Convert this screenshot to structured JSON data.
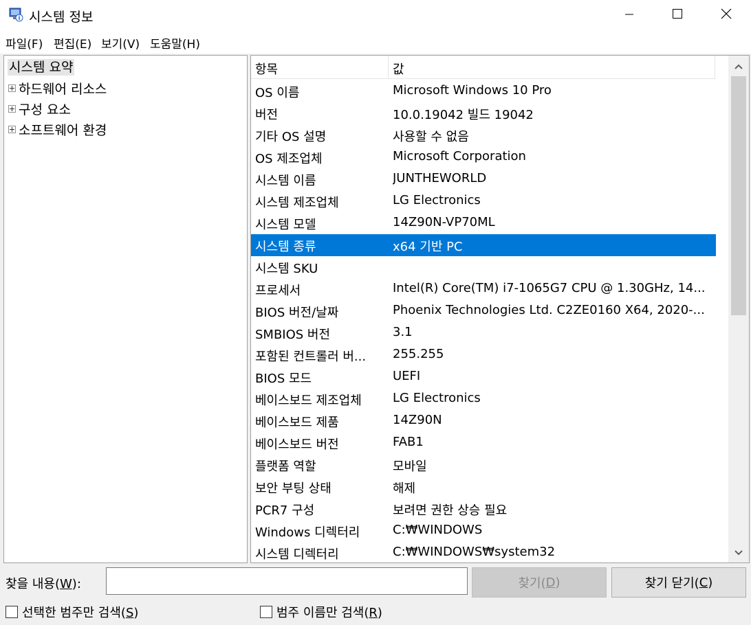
{
  "window": {
    "title": "시스템 정보"
  },
  "menu": [
    "파일(F)",
    "편집(E)",
    "보기(V)",
    "도움말(H)"
  ],
  "tree": {
    "root": "시스템 요약",
    "nodes": [
      "하드웨어 리소스",
      "구성 요소",
      "소프트웨어 환경"
    ]
  },
  "list": {
    "headers": [
      "항목",
      "값"
    ],
    "rows": [
      [
        "OS 이름",
        "Microsoft Windows 10 Pro"
      ],
      [
        "버전",
        "10.0.19042 빌드 19042"
      ],
      [
        "기타 OS 설명",
        "사용할 수 없음"
      ],
      [
        "OS 제조업체",
        "Microsoft Corporation"
      ],
      [
        "시스템 이름",
        "JUNTHEWORLD"
      ],
      [
        "시스템 제조업체",
        "LG Electronics"
      ],
      [
        "시스템 모델",
        "14Z90N-VP70ML"
      ],
      [
        "시스템 종류",
        "x64 기반 PC"
      ],
      [
        "시스템 SKU",
        ""
      ],
      [
        "프로세서",
        "Intel(R) Core(TM) i7-1065G7 CPU @ 1.30GHz, 14..."
      ],
      [
        "BIOS 버전/날짜",
        "Phoenix Technologies Ltd. C2ZE0160 X64, 2020-..."
      ],
      [
        "SMBIOS 버전",
        "3.1"
      ],
      [
        "포함된 컨트롤러 버...",
        "255.255"
      ],
      [
        "BIOS 모드",
        "UEFI"
      ],
      [
        "베이스보드 제조업체",
        "LG Electronics"
      ],
      [
        "베이스보드 제품",
        "14Z90N"
      ],
      [
        "베이스보드 버전",
        "FAB1"
      ],
      [
        "플랫폼 역할",
        "모바일"
      ],
      [
        "보안 부팅 상태",
        "해제"
      ],
      [
        "PCR7 구성",
        "보려면 권한 상승 필요"
      ],
      [
        "Windows 디렉터리",
        "C:₩WINDOWS"
      ],
      [
        "시스템 디렉터리",
        "C:₩WINDOWS₩system32"
      ]
    ],
    "selected_index": 7
  },
  "find": {
    "label_prefix": "찾을 내용(",
    "label_key": "W",
    "label_suffix": "):",
    "value": "",
    "find_button_prefix": "찾기(",
    "find_button_key": "D",
    "find_button_suffix": ")",
    "close_button_prefix": "찾기 닫기(",
    "close_button_key": "C",
    "close_button_suffix": ")",
    "check1_prefix": "선택한 범주만 검색(",
    "check1_key": "S",
    "check1_suffix": ")",
    "check2_prefix": "범주 이름만 검색(",
    "check2_key": "R",
    "check2_suffix": ")",
    "check1_checked": false,
    "check2_checked": false
  },
  "colors": {
    "selection": "#0078d7",
    "window_bg": "#f0f0f0"
  },
  "icons": [
    "system-info-icon",
    "minimize-icon",
    "maximize-icon",
    "close-icon",
    "expand-icon",
    "scroll-up-icon",
    "scroll-down-icon"
  ]
}
